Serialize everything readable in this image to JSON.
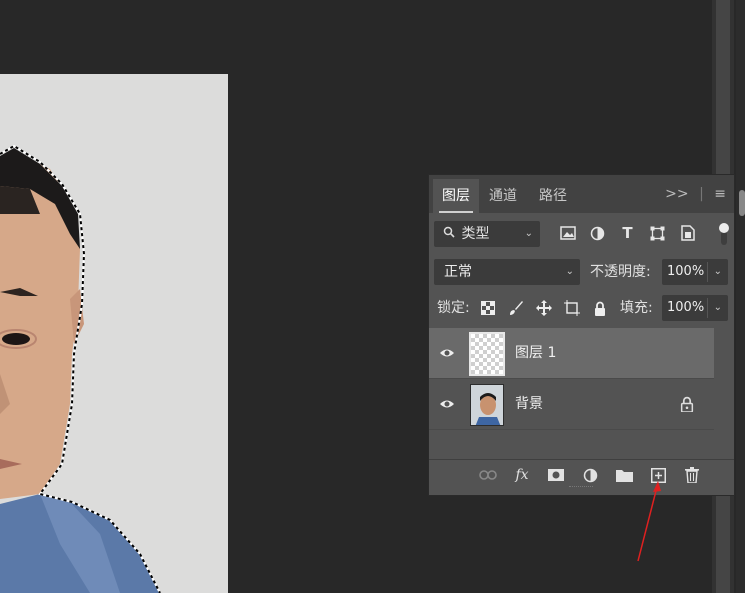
{
  "layers_panel": {
    "tabs": [
      {
        "label": "图层",
        "active": true
      },
      {
        "label": "通道",
        "active": false
      },
      {
        "label": "路径",
        "active": false
      }
    ],
    "tab_tools": {
      "collapse_icon": ">>",
      "menu_icon": "≡"
    },
    "filter": {
      "label": "类型",
      "icons": [
        "image-filter-icon",
        "adjustment-filter-icon",
        "type-filter-icon",
        "shape-filter-icon",
        "smart-object-filter-icon"
      ]
    },
    "blend": {
      "mode": "正常",
      "opacity_label": "不透明度:",
      "opacity_value": "100%"
    },
    "lock": {
      "label": "锁定:",
      "fill_label": "填充:",
      "fill_value": "100%"
    },
    "layers": [
      {
        "name": "图层 1",
        "selected": true,
        "visible": true,
        "locked": false
      },
      {
        "name": "背景",
        "selected": false,
        "visible": true,
        "locked": true
      }
    ],
    "bottom_icons": [
      "link-layers-icon",
      "fx-icon",
      "add-mask-icon",
      "adjustment-layer-icon",
      "new-group-icon",
      "new-layer-icon",
      "delete-layer-icon"
    ]
  },
  "annotation": {
    "arrow_color": "#e02020",
    "points_to": "new-layer-button"
  },
  "colors": {
    "workspace": "#282828",
    "panel": "#535353",
    "selected_layer": "#6a6a6a"
  }
}
